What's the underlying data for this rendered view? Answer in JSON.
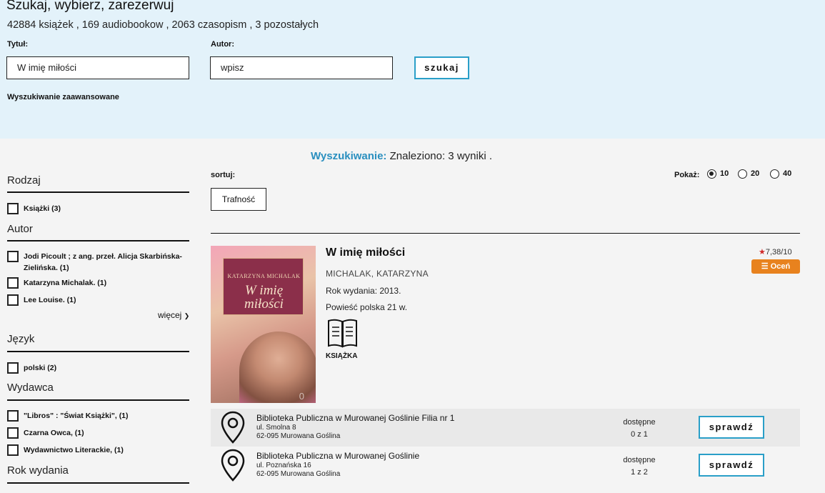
{
  "header": {
    "heading": "Szukaj, wybierz, zarezerwuj",
    "counts": "42884 książek , 169 audiobookow , 2063 czasopism , 3 pozostałych"
  },
  "search": {
    "title_label": "Tytuł:",
    "title_value": "W imię miłości",
    "author_label": "Autor:",
    "author_value": "wpisz",
    "button": "szukaj",
    "advanced": "Wyszukiwanie zaawansowane"
  },
  "results": {
    "label": "Wyszukiwanie:",
    "text": "Znaleziono: 3 wyniki ."
  },
  "sidebar": {
    "sections": [
      {
        "title": "Rodzaj",
        "items": [
          "Książki (3)"
        ]
      },
      {
        "title": "Autor",
        "items": [
          "Jodi Picoult ; z ang. przeł. Alicja Skarbińska-Zielińska. (1)",
          "Katarzyna Michalak. (1)",
          "Lee Louise. (1)"
        ]
      },
      {
        "title": "Język",
        "items": [
          "polski (2)"
        ]
      },
      {
        "title": "Wydawca",
        "items": [
          "\"Libros\" : \"Świat Książki\", (1)",
          "Czarna Owca, (1)",
          "Wydawnictwo Literackie, (1)"
        ]
      },
      {
        "title": "Rok wydania",
        "items": []
      }
    ],
    "more": "więcej"
  },
  "sort": {
    "label": "sortuj:",
    "button": "Trafność",
    "show_label": "Pokaż:",
    "options": [
      "10",
      "20",
      "40"
    ],
    "selected": "10"
  },
  "book": {
    "cover_author": "KATARZYNA MICHALAK",
    "cover_title_1": "W imię",
    "cover_title_2": "miłości",
    "cover_num": "0",
    "title": "W imię miłości",
    "author": "MICHALAK, KATARZYNA",
    "year": "Rok wydania: 2013.",
    "genre": "Powieść polska 21 w.",
    "type": "KSIĄŻKA",
    "rating": "7,38/10",
    "rate_button": "Oceń"
  },
  "libraries": [
    {
      "name": "Biblioteka Publiczna w Murowanej Goślinie Filia nr 1",
      "street": "ul. Smolna 8",
      "city": "62-095 Murowana Goślina",
      "status": "dostępne",
      "count": "0 z 1",
      "button": "sprawdź"
    },
    {
      "name": "Biblioteka Publiczna w Murowanej Goślinie",
      "street": "ul. Poznańska 16",
      "city": "62-095 Murowana Goślina",
      "status": "dostępne",
      "count": "1 z 2",
      "button": "sprawdź"
    }
  ],
  "colors": {
    "accent": "#2a9fc8",
    "rate": "#e8821e",
    "header_bg": "#e3f2fa"
  }
}
